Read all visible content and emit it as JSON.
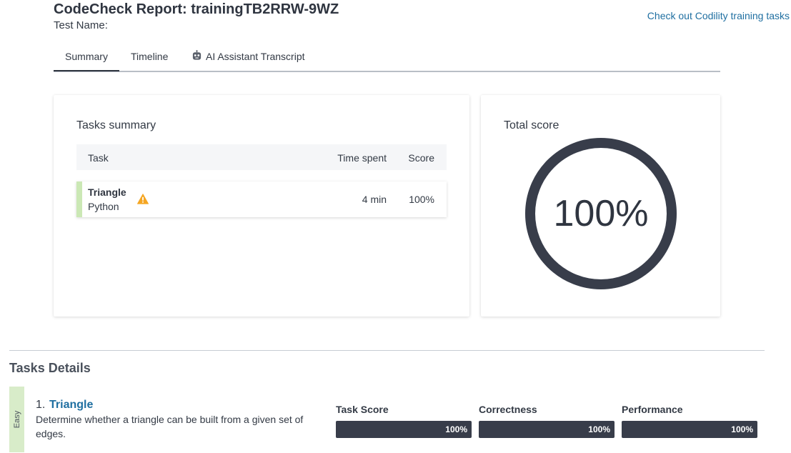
{
  "header": {
    "title": "CodeCheck Report: trainingTB2RRW-9WZ",
    "test_name_label": "Test Name:",
    "training_link": "Check out Codility training tasks"
  },
  "tabs": [
    {
      "label": "Summary",
      "active": true
    },
    {
      "label": "Timeline",
      "active": false
    },
    {
      "label": "AI Assistant Transcript",
      "active": false,
      "icon": "robot-icon"
    }
  ],
  "tasks_summary": {
    "title": "Tasks summary",
    "columns": {
      "task": "Task",
      "time": "Time spent",
      "score": "Score"
    },
    "rows": [
      {
        "name": "Triangle",
        "language": "Python",
        "icon": "warning-icon",
        "time": "4 min",
        "score": "100%"
      }
    ]
  },
  "total_score": {
    "title": "Total score",
    "value": "100%",
    "fraction": 1.0
  },
  "tasks_details": {
    "title": "Tasks Details",
    "items": [
      {
        "difficulty": "Easy",
        "number": "1.",
        "name": "Triangle",
        "description": "Determine whether a triangle can be built from a given set of edges.",
        "metrics": [
          {
            "label": "Task Score",
            "value": "100%",
            "fraction": 1.0
          },
          {
            "label": "Correctness",
            "value": "100%",
            "fraction": 1.0
          },
          {
            "label": "Performance",
            "value": "100%",
            "fraction": 1.0
          }
        ]
      }
    ]
  },
  "colors": {
    "accent_link": "#1f6fa1",
    "dark": "#383d4a",
    "easy_green": "#d8ecc9",
    "task_row_green": "#cbe8b5",
    "warning": "#f5a623"
  }
}
